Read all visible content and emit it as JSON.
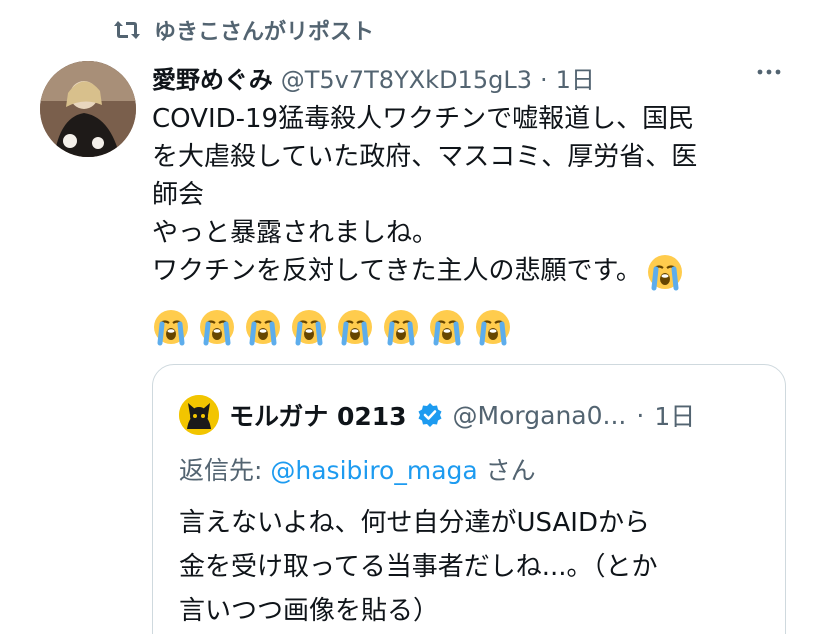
{
  "repost": {
    "text": "ゆきこさんがリポスト",
    "icon": "repost-icon"
  },
  "tweet": {
    "author_name": "愛野めぐみ",
    "handle": "@T5v7T8YXkD15gL3",
    "separator": "·",
    "time": "1日",
    "more_icon": "more-options-icon",
    "text_lines": [
      "COVID-19猛毒殺人ワクチンで嘘報道し、国民",
      "を大虐殺していた政府、マスコミ、厚労省、医",
      "師会",
      "やっと暴露されましね。",
      "ワクチンを反対してきた主人の悲願です。"
    ],
    "emoji": "loudly-crying-face",
    "emoji_count_end_of_line": 1,
    "emoji_row_count": 8
  },
  "quote": {
    "author_name": "モルガナ 0213",
    "verified": true,
    "handle": "@Morgana0...",
    "separator": "·",
    "time": "1日",
    "reply_prefix": "返信先: ",
    "reply_mention": "@hasibiro_maga",
    "reply_suffix": " さん",
    "text_lines": [
      "言えないよね、何せ自分達がUSAIDから",
      "金を受け取ってる当事者だしね...。（とか",
      "言いつつ画像を貼る）"
    ]
  },
  "colors": {
    "text": "#0f1419",
    "secondary": "#536471",
    "link": "#1d9bf0",
    "border": "#cfd9de",
    "verified": "#1d9bf0"
  }
}
